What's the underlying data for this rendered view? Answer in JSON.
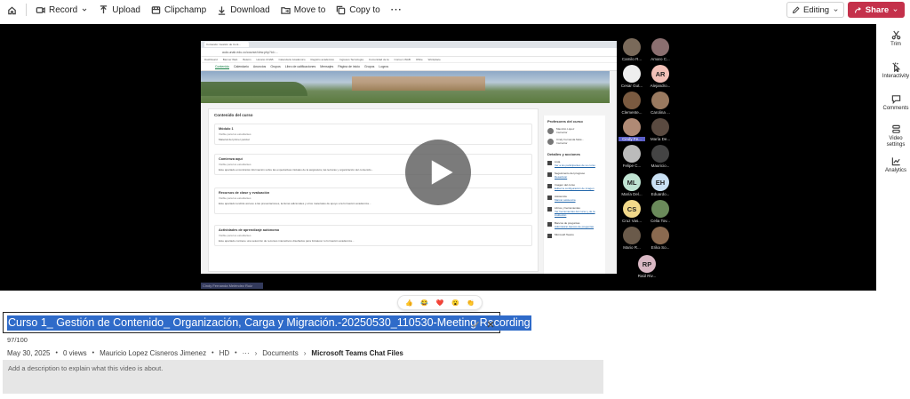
{
  "toolbar": {
    "record": "Record",
    "upload": "Upload",
    "clipchamp": "Clipchamp",
    "download": "Download",
    "move_to": "Move to",
    "copy_to": "Copy to",
    "more": "···",
    "editing": "Editing",
    "share": "Share"
  },
  "browser": {
    "tab": "Cursando: Gestión de Cont...",
    "url": "aula.unab.edu.co/course/view.php?id=...",
    "bookmarks": [
      "Dashboard",
      "Banner Web",
      "Boletin",
      "Horario UNAB",
      "Calendario Académico",
      "Registro académico",
      "Ingresos Tecnología",
      "Comunidad de la",
      "Correo UNAB",
      "Office",
      "Workplace"
    ],
    "nav": [
      "Contenido",
      "Calendario",
      "Anuncios",
      "Grupos",
      "Libro de calificaciones",
      "Mensajes",
      "Página de inicio",
      "Grupos",
      "Logros"
    ],
    "course_title": "Contenido del curso",
    "modules": [
      {
        "title": "Módulo 1",
        "status": "Visible para los estudiantes",
        "desc": "Material del primer parcial"
      },
      {
        "title": "Comienza aquí",
        "status": "Visible para los estudiantes",
        "desc": "Este apartado encontrarás información sobre las expectativas iniciales de la asignatura, las lecturas y organización del contenido..."
      },
      {
        "title": "Recursos de clase y evaluación",
        "status": "Visible para los estudiantes",
        "desc": "Este apartado tendrás acceso a las presentaciones, lecturas adicionales y otros materiales de apoyo a la formación académica..."
      },
      {
        "title": "Actividades de aprendizaje autónomo",
        "status": "Visible para los estudiantes",
        "desc": "Este apartado contiene una selección de recursos interactivos diseñados para fortalecer tu formación académica..."
      }
    ],
    "side_head": "Profesores del curso",
    "teachers": [
      {
        "name": "Mauricio López",
        "role": "Instructor"
      },
      {
        "name": "Cindy Fernanda Melé...",
        "role": "Instructor"
      }
    ],
    "details_head": "Detalles y acciones",
    "details": [
      {
        "title": "Lista",
        "link": "Ver a los participantes de su curso"
      },
      {
        "title": "Seguimiento del progreso",
        "link": "Desactivar"
      },
      {
        "title": "Imagen del curso",
        "link": "Editar la configuración de imagen"
      },
      {
        "title": "Asistencia",
        "link": "Marcar asistencia"
      },
      {
        "title": "Libros y herramientas",
        "link": "Ver herramientas del curso y de la institución"
      },
      {
        "title": "Bancos de preguntas",
        "link": "Administrar bancos de preguntas"
      },
      {
        "title": "Microsoft Teams",
        "link": ""
      }
    ]
  },
  "participants": [
    {
      "name": "Camilo R...",
      "initials": "",
      "color": "#7a6a5a"
    },
    {
      "name": "Amaro C...",
      "initials": "",
      "color": "#8b6f70"
    },
    {
      "name": "Cesar Gut...",
      "initials": "",
      "color": "#eeeeee"
    },
    {
      "name": "Alejandro...",
      "initials": "AR",
      "color": "#f3c1b8"
    },
    {
      "name": "Clemente...",
      "initials": "",
      "color": "#7a5a40"
    },
    {
      "name": "Carolina ...",
      "initials": "",
      "color": "#9a7a60"
    },
    {
      "name": "Cindy Fe...",
      "initials": "",
      "color": "#b08a75"
    },
    {
      "name": "María De...",
      "initials": "",
      "color": "#5a4a40"
    },
    {
      "name": "Felipe C...",
      "initials": "",
      "color": "#bbbbbb"
    },
    {
      "name": "Mauricio...",
      "initials": "",
      "color": "#444444"
    },
    {
      "name": "María Del...",
      "initials": "ML",
      "color": "#bfe3d2"
    },
    {
      "name": "Eduardo...",
      "initials": "EH",
      "color": "#c9e0f3"
    },
    {
      "name": "Cruz Vas...",
      "initials": "CS",
      "color": "#f2d98a"
    },
    {
      "name": "Celia Tov...",
      "initials": "",
      "color": "#6a8a5a"
    },
    {
      "name": "Mario R...",
      "initials": "",
      "color": "#6a5a4a"
    },
    {
      "name": "Erika So...",
      "initials": "",
      "color": "#8a6a50"
    },
    {
      "name": "Raúl Riv...",
      "initials": "RP",
      "color": "#d9b8c4"
    }
  ],
  "caption_chip": "Cindy Fernanda Meléndez Ruiz",
  "rail": {
    "trim": "Trim",
    "interactivity": "Interactivity",
    "comments": "Comments",
    "video_settings_1": "Video",
    "video_settings_2": "settings",
    "analytics": "Analytics"
  },
  "reactions": [
    "👍",
    "😂",
    "❤️",
    "😮",
    "👏"
  ],
  "title": {
    "value": "Curso 1_ Gestión de Contenido_ Organización, Carga y Migración.-20250530_110530-Meeting Recording",
    "counter": "97/100"
  },
  "meta": {
    "date": "May 30, 2025",
    "views": "0 views",
    "author": "Mauricio Lopez Cisneros Jimenez",
    "quality": "HD",
    "more": "···",
    "crumb1": "Documents",
    "crumb2": "Microsoft Teams Chat Files"
  },
  "description": {
    "placeholder": "Add a description to explain what this video is about."
  },
  "colors": {
    "share": "#c4314b",
    "selection": "#2f6bc9",
    "player_bg": "#000000"
  }
}
